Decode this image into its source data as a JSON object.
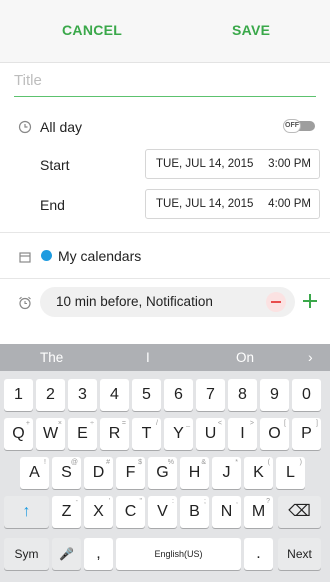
{
  "header": {
    "cancel_label": "CANCEL",
    "save_label": "SAVE"
  },
  "title_field": {
    "placeholder": "Title",
    "value": ""
  },
  "all_day": {
    "label": "All day",
    "toggle_text": "OFF"
  },
  "start": {
    "label": "Start",
    "date": "TUE, JUL 14, 2015",
    "time": "3:00 PM"
  },
  "end": {
    "label": "End",
    "date": "TUE, JUL 14, 2015",
    "time": "4:00 PM"
  },
  "calendar": {
    "label": "My calendars",
    "color": "#1e9be0"
  },
  "reminder": {
    "label": "10 min before, Notification"
  },
  "keyboard": {
    "suggestions": [
      "The",
      "I",
      "On"
    ],
    "suggestion_arrow": "›",
    "row1": [
      "1",
      "2",
      "3",
      "4",
      "5",
      "6",
      "7",
      "8",
      "9",
      "0"
    ],
    "row2": [
      {
        "k": "Q",
        "s": "+"
      },
      {
        "k": "W",
        "s": "×"
      },
      {
        "k": "E",
        "s": "÷"
      },
      {
        "k": "R",
        "s": "="
      },
      {
        "k": "T",
        "s": "/"
      },
      {
        "k": "Y",
        "s": "_"
      },
      {
        "k": "U",
        "s": "<"
      },
      {
        "k": "I",
        "s": ">"
      },
      {
        "k": "O",
        "s": "["
      },
      {
        "k": "P",
        "s": "]"
      }
    ],
    "row3": [
      {
        "k": "A",
        "s": "!"
      },
      {
        "k": "S",
        "s": "@"
      },
      {
        "k": "D",
        "s": "#"
      },
      {
        "k": "F",
        "s": "$"
      },
      {
        "k": "G",
        "s": "%"
      },
      {
        "k": "H",
        "s": "&"
      },
      {
        "k": "J",
        "s": "*"
      },
      {
        "k": "K",
        "s": "("
      },
      {
        "k": "L",
        "s": ")"
      }
    ],
    "row4": [
      {
        "k": "Z",
        "s": "-"
      },
      {
        "k": "X",
        "s": "'"
      },
      {
        "k": "C",
        "s": "\""
      },
      {
        "k": "V",
        "s": ":"
      },
      {
        "k": "B",
        "s": ";"
      },
      {
        "k": "N",
        "s": ","
      },
      {
        "k": "M",
        "s": "?"
      }
    ],
    "shift_icon": "↑",
    "backspace_icon": "⌫",
    "sym_label": "Sym",
    "mic_icon": "🎤",
    "comma": ",",
    "space_label": "English(US)",
    "period": ".",
    "next_label": "Next"
  }
}
